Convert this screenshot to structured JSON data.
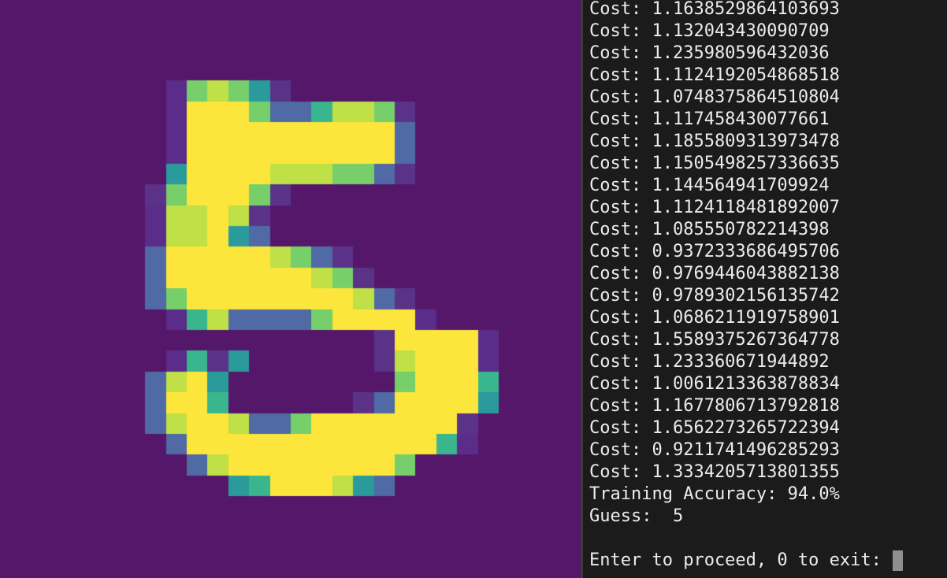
{
  "digit_image": {
    "rows": [
      "............................",
      "............................",
      "............................",
      ".........afgfcb.............",
      ".........ahhhfddeggfb.......",
      ".........ahhhhhhhhhhd.......",
      ".........ahhhhhhhhhhd.......",
      ".........chhhhgggffdb.......",
      "........bfhhhfb.............",
      "........agghgb..............",
      "........agghcd..............",
      "........dhhhhhgfdb..........",
      "........dhhhhhhhgfb.........",
      "........dfhhhhhhhhgdb.......",
      ".........aegddddfhhhha......",
      "...................bhhhha...",
      ".........aebc......bghhha...",
      "........dghc........fhhhe...",
      "........dhhe......bdhhhhc...",
      "........dghhgddfhhhhhhhb....",
      ".........dhhhhhhhhhhhhea....",
      "..........dghhhhhhhhf.......",
      "............cehhhgcd........",
      "............................",
      "............................",
      "............................",
      "............................",
      "............................"
    ],
    "palette": {
      ".": "#55176a",
      "a": "#5b2d8a",
      "b": "#5a3388",
      "c": "#2a9b9a",
      "d": "#4f6aa4",
      "e": "#39b68d",
      "f": "#76cf6a",
      "g": "#bfe046",
      "h": "#fde63c"
    }
  },
  "terminal": {
    "lines": [
      "Cost: 1.1638529864103693",
      "Cost: 1.132043430090709",
      "Cost: 1.235980596432036",
      "Cost: 1.1124192054868518",
      "Cost: 1.0748375864510804",
      "Cost: 1.117458430077661",
      "Cost: 1.1855809313973478",
      "Cost: 1.1505498257336635",
      "Cost: 1.144564941709924",
      "Cost: 1.1124118481892007",
      "Cost: 1.085550782214398",
      "Cost: 0.9372333686495706",
      "Cost: 0.9769446043882138",
      "Cost: 0.9789302156135742",
      "Cost: 1.0686211919758901",
      "Cost: 1.5589375267364778",
      "Cost: 1.233360671944892",
      "Cost: 1.0061213363878834",
      "Cost: 1.1677806713792818",
      "Cost: 1.6562273265722394",
      "Cost: 0.9211741496285293",
      "Cost: 1.3334205713801355",
      "Training Accuracy: 94.0%",
      "Guess:  5",
      ""
    ],
    "prompt": "Enter to proceed, 0 to exit: "
  }
}
